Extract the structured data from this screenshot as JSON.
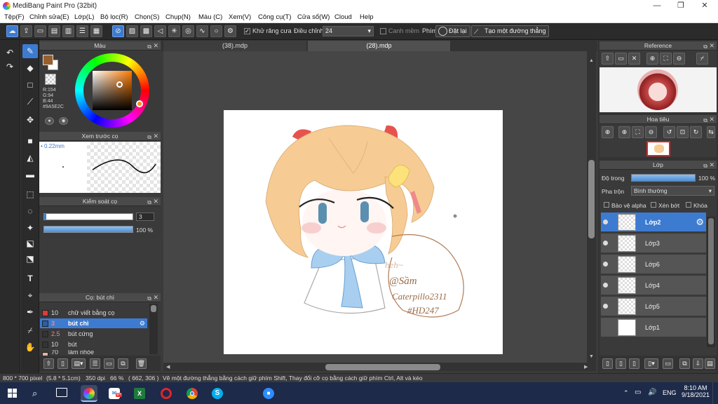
{
  "window": {
    "title": "MediBang Paint Pro (32bit)",
    "minimize": "—",
    "maximize": "❐",
    "close": "✕"
  },
  "menu": [
    "Tệp(F)",
    "Chỉnh sửa(E)",
    "Lớp(L)",
    "Bộ lọc(R)",
    "Chọn(S)",
    "Chụp(N)",
    "Màu (C)",
    "Xem(V)",
    "Công cụ(T)",
    "Cửa sổ(W)",
    "Cloud",
    "Help"
  ],
  "toolbar": {
    "antialias_label": "Khử răng cưa",
    "correction_label": "Điều chỉnh",
    "correction_value": "24",
    "soft_edge_label": "Canh mềm",
    "key_label": "Phím",
    "reset_label": "Đặt lại",
    "straight_line_label": "Tạo một đường thẳng"
  },
  "color_panel": {
    "title": "Màu",
    "r": "R:154",
    "g": "G:94",
    "b": "B:44",
    "hex": "#9A5E2C",
    "fg_color": "#9a5e2c",
    "bg_color": "#ffffff"
  },
  "brush_preview": {
    "title": "Xem trước cọ",
    "size": "0.22mm"
  },
  "brush_control": {
    "title": "Kiểm soát cọ",
    "size_value": "3",
    "opacity_value": "100 %"
  },
  "brush_list": {
    "title": "Cọ: bút chì",
    "items": [
      {
        "size": "10",
        "name": "chữ viết bằng cọ",
        "color": "#e03a3a"
      },
      {
        "size": "3",
        "name": "bút chì",
        "color": "#3d7bd1",
        "selected": true
      },
      {
        "size": "2.5",
        "name": "bút cứng",
        "color": "#555555"
      },
      {
        "size": "10",
        "name": "bút",
        "color": "#555555"
      },
      {
        "size": "70",
        "name": "làm nhòe",
        "color": "#e8b0a0"
      }
    ]
  },
  "tabs": [
    {
      "label": "(38).mdp"
    },
    {
      "label": "(28).mdp",
      "active": true
    }
  ],
  "artwork": {
    "signature_line1": "heh~",
    "signature_line2": "@Sầm",
    "signature_line3": "Caterpillo2311",
    "signature_line4": "#HD247"
  },
  "reference_panel": {
    "title": "Reference"
  },
  "navigator_panel": {
    "title": "Hoa tiêu"
  },
  "layer_panel": {
    "title": "Lớp",
    "opacity_label": "Độ trong",
    "opacity_value": "100 %",
    "blend_label": "Pha trộn",
    "blend_value": "Bình thường",
    "protect_alpha": "Bảo vệ alpha",
    "clipping": "Xén bớt",
    "lock": "Khóa",
    "layers": [
      {
        "name": "Lớp2",
        "selected": true
      },
      {
        "name": "Lớp3"
      },
      {
        "name": "Lớp6"
      },
      {
        "name": "Lớp4"
      },
      {
        "name": "Lớp5"
      },
      {
        "name": "Lớp1"
      }
    ]
  },
  "status": {
    "size": "800 * 700 pixel",
    "cm": "(5.8 * 5.1cm)",
    "dpi": "350 dpi",
    "zoom": "66 %",
    "coords": "( 662, 306 )",
    "hint": "Vẽ một đường thẳng bằng cách giữ phím Shift, Thay đổi cỡ cọ bằng cách giữ phím Ctrl, Alt và kéo"
  },
  "taskbar": {
    "lang": "ENG",
    "time": "8:10 AM",
    "date": "9/18/2021",
    "badge": "9+"
  }
}
